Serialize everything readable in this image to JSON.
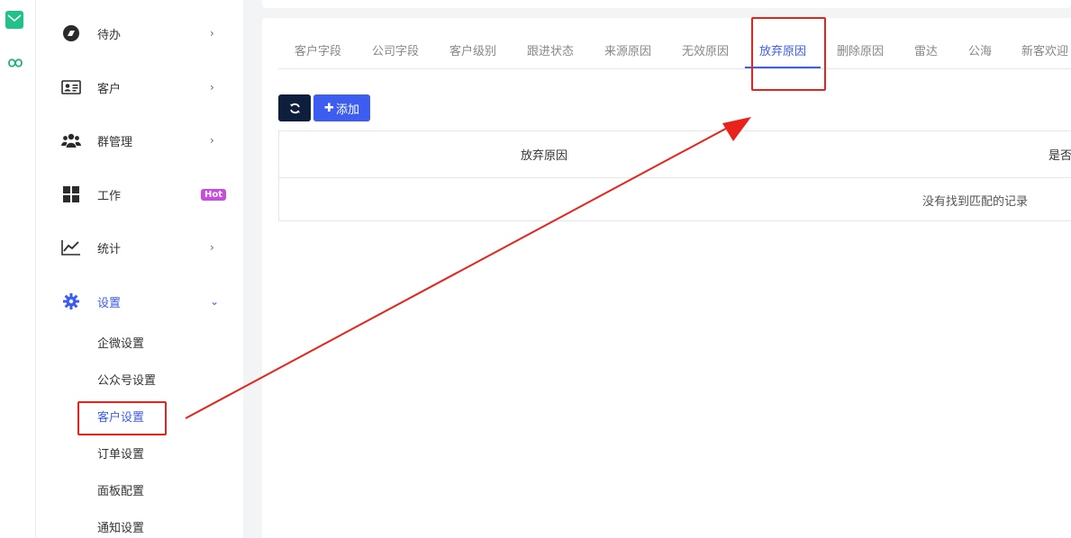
{
  "sidebar": {
    "items": [
      {
        "label": "待办",
        "icon": "todo-icon",
        "chevron": "›"
      },
      {
        "label": "客户",
        "icon": "customer-card-icon",
        "chevron": "›"
      },
      {
        "label": "群管理",
        "icon": "group-icon",
        "chevron": "›"
      },
      {
        "label": "工作",
        "icon": "grid-icon",
        "badge": "Hot"
      },
      {
        "label": "统计",
        "icon": "chart-icon",
        "chevron": "›"
      },
      {
        "label": "设置",
        "icon": "gear-icon",
        "chevron": "⌄"
      }
    ],
    "settings_submenu": [
      "企微设置",
      "公众号设置",
      "客户设置",
      "订单设置",
      "面板配置",
      "通知设置"
    ],
    "active_sub": "客户设置"
  },
  "tabs": [
    "客户字段",
    "公司字段",
    "客户级别",
    "跟进状态",
    "来源原因",
    "无效原因",
    "放弃原因",
    "删除原因",
    "雷达",
    "公海",
    "新客欢迎"
  ],
  "active_tab": "放弃原因",
  "toolbar": {
    "add_label": "添加",
    "plus": "✚"
  },
  "table": {
    "columns": [
      "放弃原因",
      "是否"
    ],
    "empty_text": "没有找到匹配的记录"
  },
  "colors": {
    "accent": "#3d5cf0",
    "dark_button": "#0e1e3d",
    "annotation": "#e8231c",
    "hot_badge": "#c94cdf"
  }
}
